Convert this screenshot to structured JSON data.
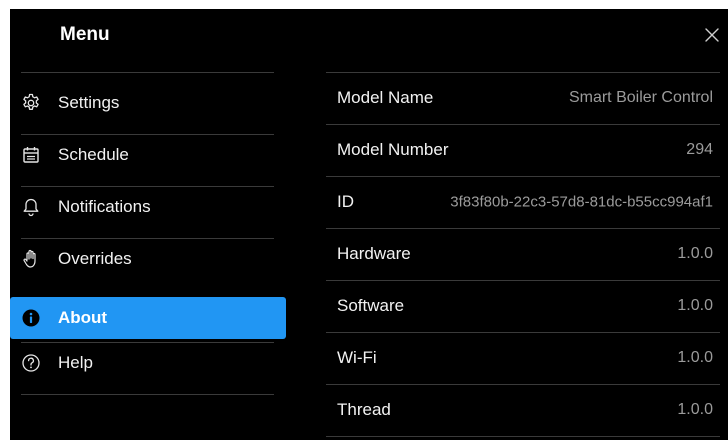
{
  "header": {
    "title": "Menu",
    "close_icon": "close-icon"
  },
  "sidebar": {
    "items": [
      {
        "label": "Settings",
        "icon": "gear-icon",
        "active": false
      },
      {
        "label": "Schedule",
        "icon": "calendar-icon",
        "active": false
      },
      {
        "label": "Notifications",
        "icon": "bell-icon",
        "active": false
      },
      {
        "label": "Overrides",
        "icon": "hand-icon",
        "active": false
      },
      {
        "label": "About",
        "icon": "info-icon",
        "active": true
      },
      {
        "label": "Help",
        "icon": "help-icon",
        "active": false
      }
    ]
  },
  "about": {
    "rows": [
      {
        "label": "Model Name",
        "value": "Smart Boiler Control"
      },
      {
        "label": "Model Number",
        "value": "294"
      },
      {
        "label": "ID",
        "value": "3f83f80b-22c3-57d8-81dc-b55cc994af1"
      },
      {
        "label": "Hardware",
        "value": "1.0.0"
      },
      {
        "label": "Software",
        "value": "1.0.0"
      },
      {
        "label": "Wi-Fi",
        "value": "1.0.0"
      },
      {
        "label": "Thread",
        "value": "1.0.0"
      }
    ]
  },
  "colors": {
    "background": "#000000",
    "accent": "#2196f3",
    "text": "#f2f2f2",
    "muted": "#9b9b9b",
    "divider": "#3a3a3a"
  }
}
